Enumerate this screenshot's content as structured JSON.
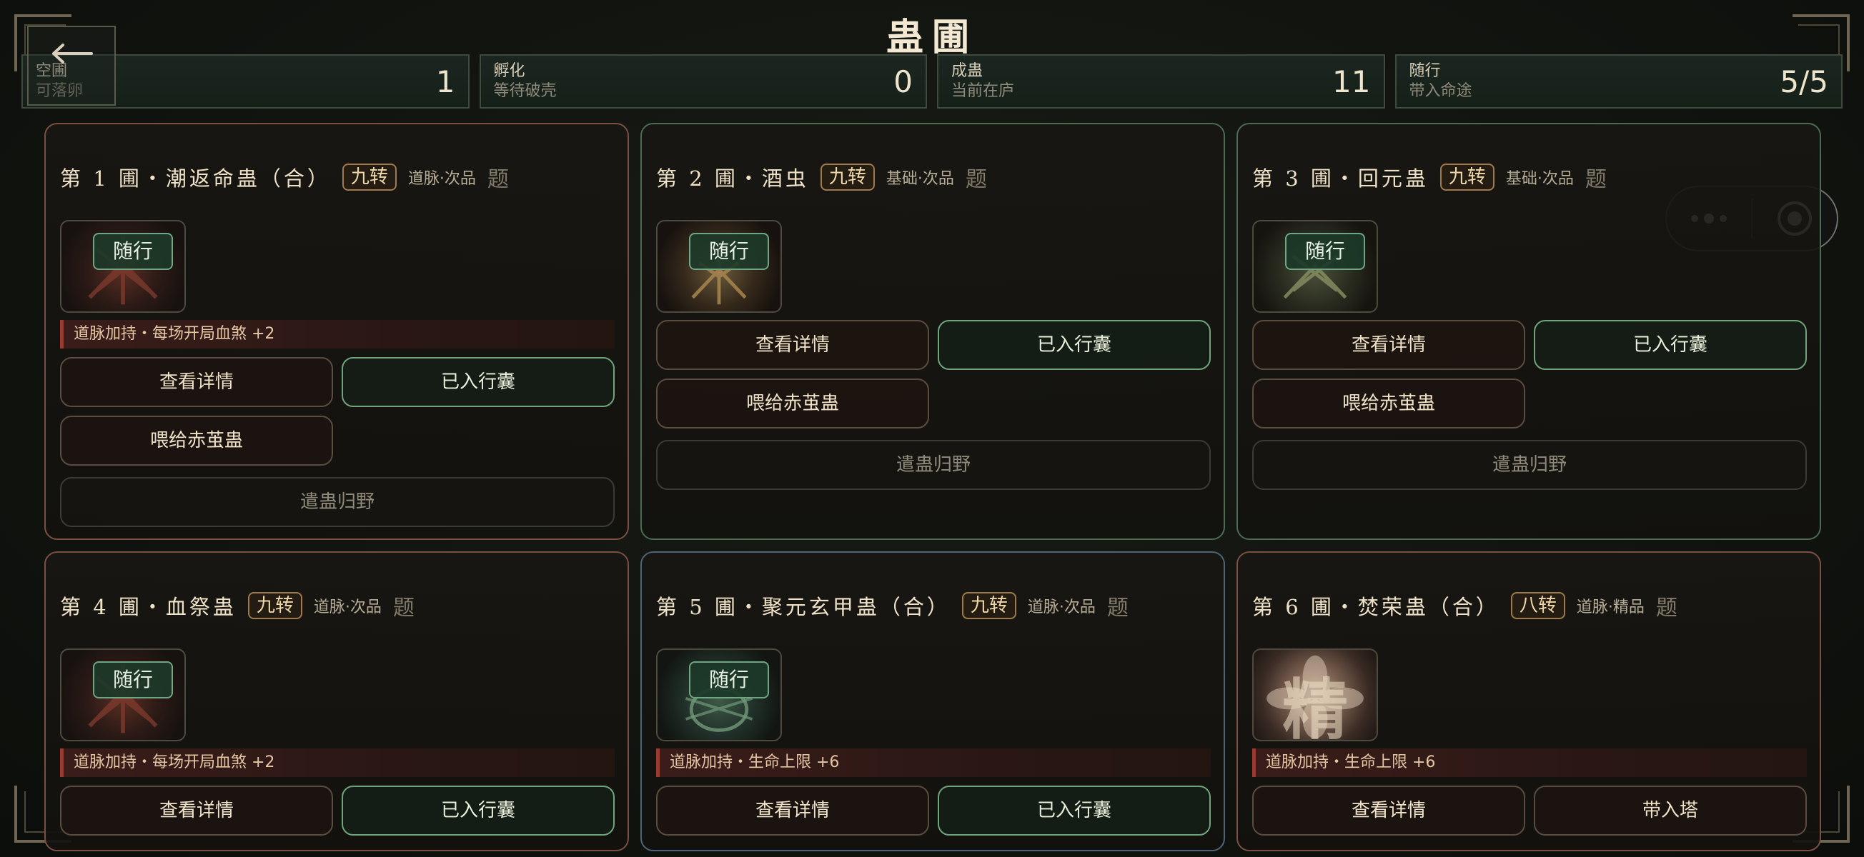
{
  "header": {
    "title": "蛊圃"
  },
  "stats": [
    {
      "label": "空圃",
      "sub": "可落卵",
      "value": "1"
    },
    {
      "label": "孵化",
      "sub": "等待破壳",
      "value": "0"
    },
    {
      "label": "成蛊",
      "sub": "当前在庐",
      "value": "11"
    },
    {
      "label": "随行",
      "sub": "带入命途",
      "value": "5/5"
    }
  ],
  "cards": [
    {
      "name": "第 1 圃・潮返命蛊（合）",
      "tier": "九转",
      "category": "道脉·次品",
      "ti": "题",
      "follow": "随行",
      "buff": "道脉加持・每场开局血煞 +2",
      "buttons": {
        "detail": "查看详情",
        "state": "已入行囊",
        "feed": "喂给赤茧蛊",
        "release": "遣蛊归野"
      }
    },
    {
      "name": "第 2 圃・酒虫",
      "tier": "九转",
      "category": "基础·次品",
      "ti": "题",
      "follow": "随行",
      "buttons": {
        "detail": "查看详情",
        "state": "已入行囊",
        "feed": "喂给赤茧蛊",
        "release": "遣蛊归野"
      }
    },
    {
      "name": "第 3 圃・回元蛊",
      "tier": "九转",
      "category": "基础·次品",
      "ti": "题",
      "follow": "随行",
      "buttons": {
        "detail": "查看详情",
        "state": "已入行囊",
        "feed": "喂给赤茧蛊",
        "release": "遣蛊归野"
      }
    },
    {
      "name": "第 4 圃・血祭蛊",
      "tier": "九转",
      "category": "道脉·次品",
      "ti": "题",
      "follow": "随行",
      "buff": "道脉加持・每场开局血煞 +2",
      "buttons": {
        "detail": "查看详情",
        "state": "已入行囊"
      }
    },
    {
      "name": "第 5 圃・聚元玄甲蛊（合）",
      "tier": "九转",
      "category": "道脉·次品",
      "ti": "题",
      "follow": "随行",
      "buff": "道脉加持・生命上限 +6",
      "buttons": {
        "detail": "查看详情",
        "state": "已入行囊"
      }
    },
    {
      "name": "第 6 圃・焚荣蛊（合）",
      "tier": "八转",
      "category": "道脉·精品",
      "ti": "题",
      "seal": "精",
      "buff": "道脉加持・生命上限 +6",
      "buttons": {
        "detail": "查看详情",
        "state": "带入塔"
      }
    }
  ],
  "icons": {
    "back": "arrow-left-icon",
    "more": "more-dots-icon",
    "target": "target-icon"
  },
  "colors": {
    "follow_green": "#6fa582",
    "buff_red": "#9a3b32",
    "tier_gold": "#a07a4a"
  }
}
